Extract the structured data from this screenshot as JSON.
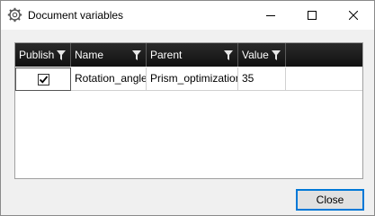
{
  "window": {
    "title": "Document variables",
    "icon": "gear-icon",
    "controls": {
      "minimize": "minimize-icon",
      "maximize": "maximize-icon",
      "close": "close-icon"
    }
  },
  "grid": {
    "columns": [
      {
        "label": "Publish"
      },
      {
        "label": "Name"
      },
      {
        "label": "Parent"
      },
      {
        "label": "Value"
      }
    ],
    "rows": [
      {
        "publish": true,
        "name": "Rotation_angle",
        "parent": "Prism_optimization",
        "value": "35"
      }
    ]
  },
  "footer": {
    "close_label": "Close"
  },
  "colors": {
    "header_bg": "#1a1a1a",
    "accent": "#0078d7",
    "window_bg": "#f0f0f0"
  }
}
